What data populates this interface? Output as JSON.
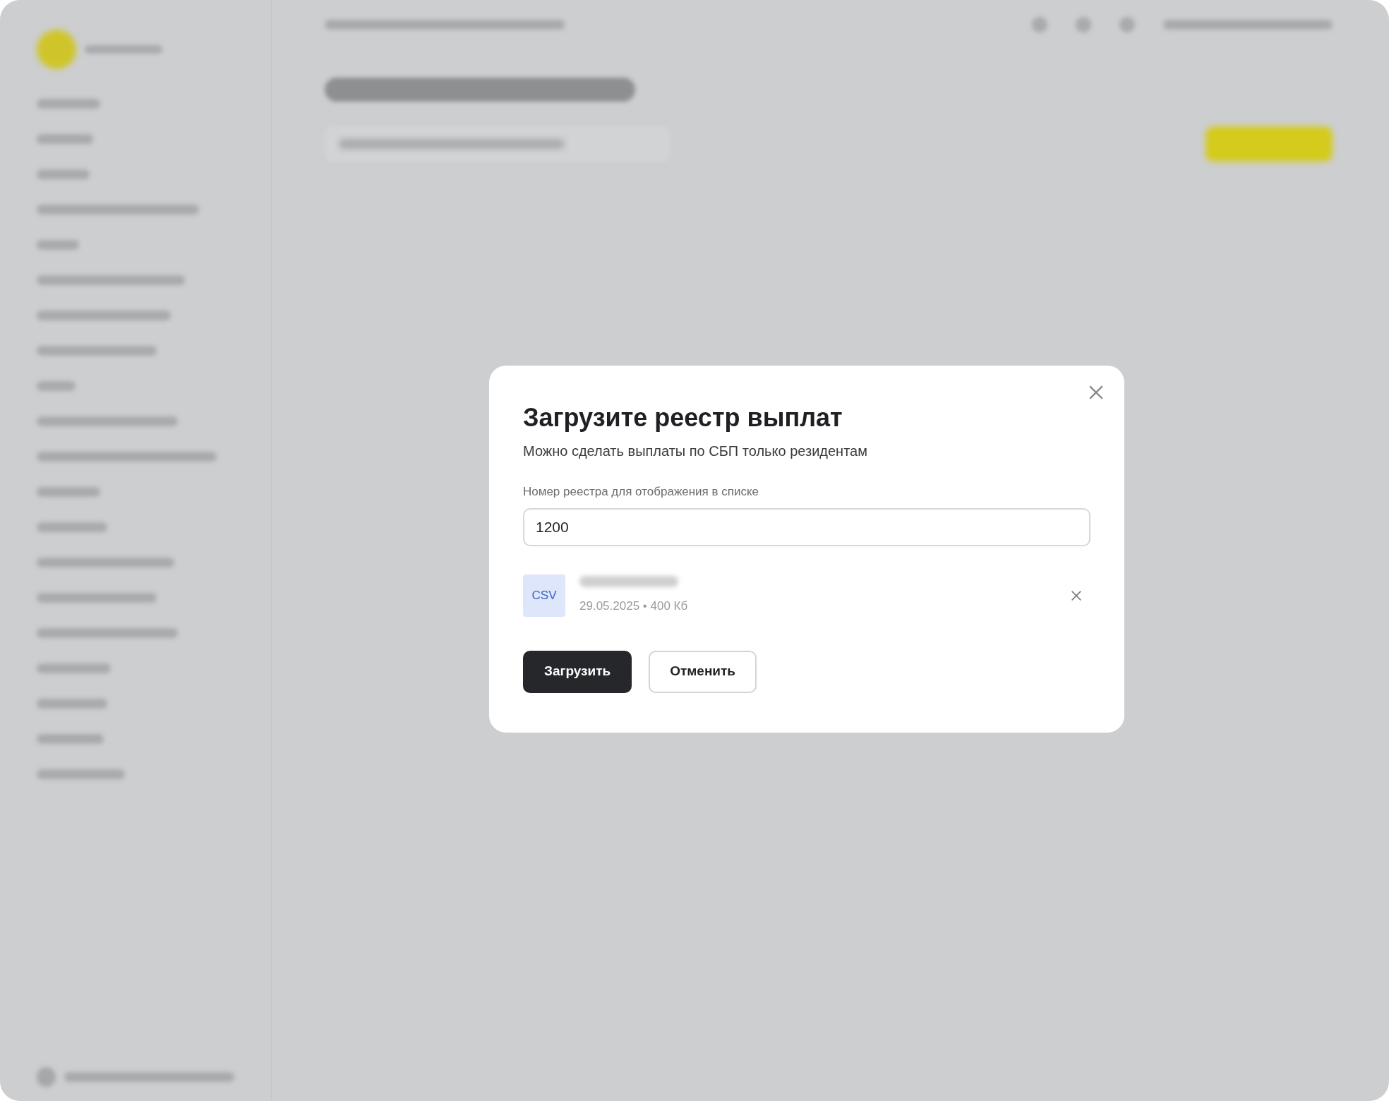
{
  "dialog": {
    "title": "Загрузите реестр выплат",
    "subtitle": "Можно сделать выплаты по СБП только резидентам",
    "field": {
      "label": "Номер реестра для отображения в списке",
      "value": "1200"
    },
    "file": {
      "type_label": "CSV",
      "meta": "29.05.2025 • 400 Кб"
    },
    "buttons": [
      {
        "label": "Загрузить",
        "kind": "primary"
      },
      {
        "label": "Отменить",
        "kind": "secondary"
      }
    ]
  }
}
